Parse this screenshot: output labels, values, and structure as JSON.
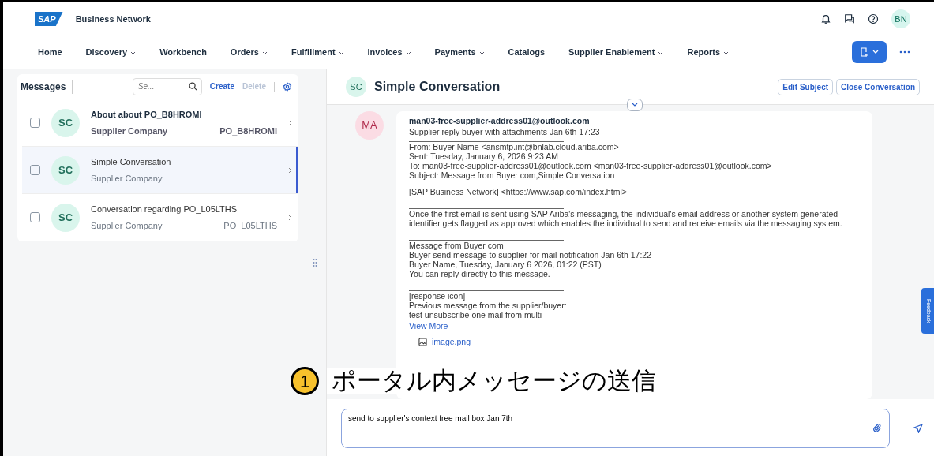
{
  "app": {
    "logo": "SAP",
    "title": "Business Network",
    "user_initials": "BN"
  },
  "nav": [
    {
      "label": "Home",
      "dropdown": false
    },
    {
      "label": "Discovery",
      "dropdown": true
    },
    {
      "label": "Workbench",
      "dropdown": false
    },
    {
      "label": "Orders",
      "dropdown": true
    },
    {
      "label": "Fulfillment",
      "dropdown": true
    },
    {
      "label": "Invoices",
      "dropdown": true
    },
    {
      "label": "Payments",
      "dropdown": true
    },
    {
      "label": "Catalogs",
      "dropdown": false
    },
    {
      "label": "Supplier Enablement",
      "dropdown": true
    },
    {
      "label": "Reports",
      "dropdown": true
    }
  ],
  "messages_panel": {
    "title": "Messages",
    "search": {
      "placeholder": "Se..."
    },
    "create": "Create",
    "delete": {
      "label": "Delete",
      "disabled": true
    },
    "items": [
      {
        "initials": "SC",
        "subject": "About about PO_B8HROMI",
        "company": "Supplier Company",
        "reference": "PO_B8HROMI",
        "unread": true,
        "selected": false,
        "checked": false
      },
      {
        "initials": "SC",
        "subject": "Simple Conversation",
        "company": "Supplier Company",
        "unread": false,
        "selected": true,
        "checked": false
      },
      {
        "initials": "SC",
        "subject": "Conversation regarding PO_L05LTHS",
        "company": "Supplier Company",
        "reference": "PO_L05LTHS",
        "unread": false,
        "selected": false,
        "checked": false
      }
    ]
  },
  "conversation": {
    "initials": "SC",
    "title": "Simple Conversation",
    "buttons": [
      "Edit Subject",
      "Close Conversation"
    ],
    "message": {
      "initials": "MA",
      "sender": "man03-free-supplier-address01@outlook.com",
      "blocks": [
        {
          "kind": "text",
          "lines": [
            "Supplier reply buyer with attachments Jan 6th 17:23"
          ]
        },
        {
          "kind": "rule"
        },
        {
          "kind": "text",
          "lines": [
            "From: Buyer Name <ansmtp.int@bnlab.cloud.ariba.com>",
            "Sent: Tuesday, January 6, 2026 9:23 AM",
            "To: man03-free-supplier-address01@outlook.com <man03-free-supplier-address01@outlook.com>",
            "Subject: Message from Buyer com,Simple Conversation"
          ]
        },
        {
          "kind": "gap"
        },
        {
          "kind": "text",
          "lines": [
            "[SAP Business Network] <https://www.sap.com/index.html>"
          ]
        },
        {
          "kind": "gap"
        },
        {
          "kind": "rule"
        },
        {
          "kind": "text",
          "lines": [
            "Once the first email is sent using SAP Ariba's messaging, the individual's email address or another system generated identifier gets flagged as approved which enables the individual to send and receive emails via the messaging system."
          ]
        },
        {
          "kind": "gap"
        },
        {
          "kind": "rule"
        },
        {
          "kind": "text",
          "lines": [
            "Message from Buyer com",
            "Buyer send message to supplier for mail notification Jan 6th 17:22",
            "Buyer Name, Tuesday, January 6 2026, 01:22 (PST)",
            "You can reply directly to this message."
          ]
        },
        {
          "kind": "gap"
        },
        {
          "kind": "rule"
        },
        {
          "kind": "text",
          "lines": [
            "[response icon]",
            "Previous message from the supplier/buyer:",
            "test unsubscribe one mail from multi"
          ]
        }
      ],
      "view_more": "View More",
      "attachments": [
        "image.png"
      ]
    },
    "composer": {
      "value": "send to supplier's context free mail box Jan 7th"
    }
  },
  "feedback": "Feedback",
  "callout": {
    "number": "1",
    "text": "ポータル内メッセージの送信"
  }
}
